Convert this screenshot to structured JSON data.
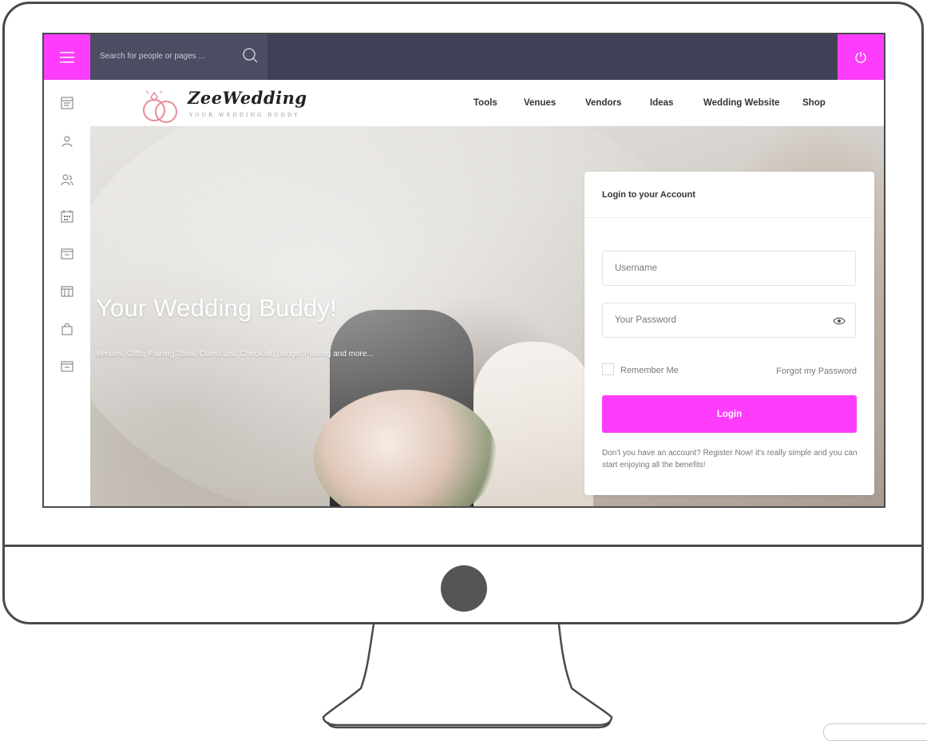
{
  "topbar": {
    "search_placeholder": "Search for people or pages ..."
  },
  "brand": {
    "name": "ZeeWedding",
    "tagline": "YOUR WEDDING BUDDY"
  },
  "nav": {
    "items": [
      "Tools",
      "Venues",
      "Vendors",
      "Ideas",
      "Wedding Website",
      "Shop"
    ]
  },
  "sidebar": {
    "icons": [
      "dashboard-icon",
      "user-icon",
      "users-icon",
      "calendar-icon",
      "browser-window-icon",
      "grid-window-icon",
      "shopping-bag-icon",
      "browser-window-icon"
    ]
  },
  "hero": {
    "title": "Your Wedding Buddy!",
    "subtitle": "Venues, Gifts, Planing Tools, Guest List, Checklist, Budget Planing and more..."
  },
  "login": {
    "title": "Login to your Account",
    "username_placeholder": "Username",
    "password_placeholder": "Your Password",
    "remember_label": "Remember Me",
    "forgot_label": "Forgot my Password",
    "button_label": "Login",
    "register_text": "Don't you have an account? Register Now! it's really simple and you can start enjoying all the benefits!"
  },
  "colors": {
    "accent": "#fd3dfb",
    "topbar": "#3f4257",
    "search_bg": "#4b4e63",
    "frame": "#4a4a4a"
  }
}
